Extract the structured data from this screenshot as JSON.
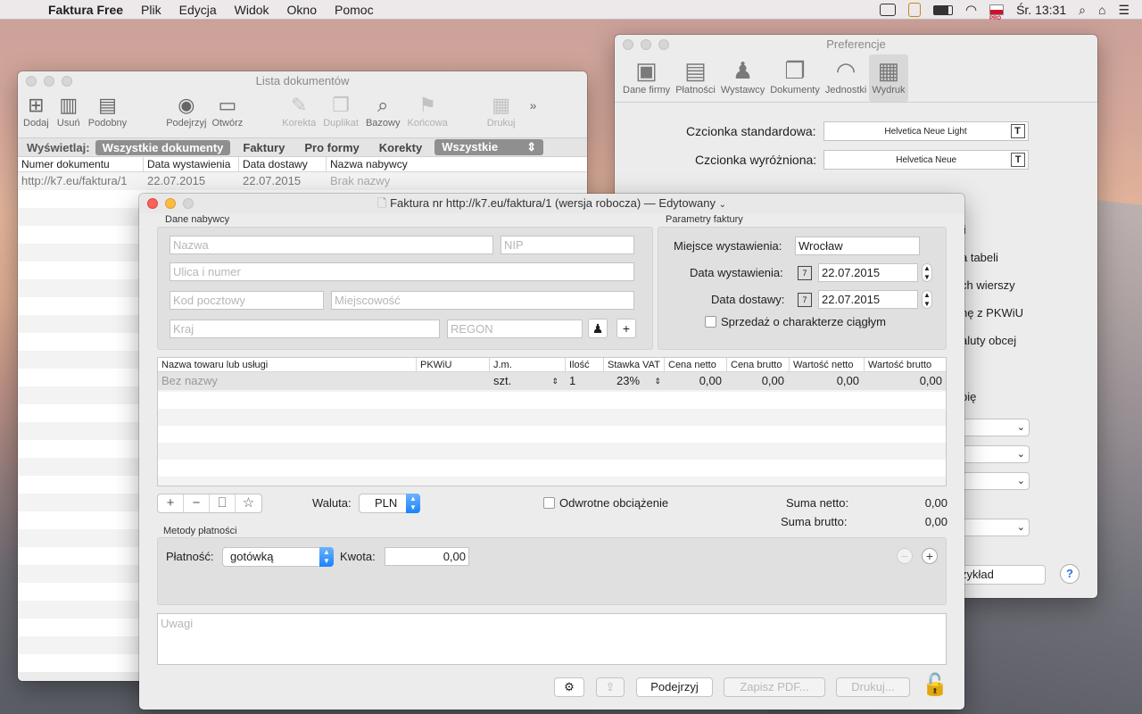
{
  "menubar": {
    "app": "Faktura Free",
    "items": [
      "Plik",
      "Edycja",
      "Widok",
      "Okno",
      "Pomoc"
    ],
    "clock": "Śr. 13:31"
  },
  "list_window": {
    "title": "Lista dokumentów",
    "toolbar": [
      {
        "label": "Dodaj",
        "icon": "add-doc-icon",
        "enabled": true
      },
      {
        "label": "Usuń",
        "icon": "trash-icon",
        "enabled": true
      },
      {
        "label": "Podobny",
        "icon": "similar-doc-icon",
        "enabled": true
      },
      {
        "label": "Podejrzyj",
        "icon": "eye-icon",
        "enabled": true
      },
      {
        "label": "Otwórz",
        "icon": "folder-icon",
        "enabled": true
      },
      {
        "label": "Korekta",
        "icon": "correction-icon",
        "enabled": false
      },
      {
        "label": "Duplikat",
        "icon": "duplicate-icon",
        "enabled": false
      },
      {
        "label": "Bazowy",
        "icon": "magnifier-doc-icon",
        "enabled": true
      },
      {
        "label": "Końcowa",
        "icon": "final-doc-icon",
        "enabled": false
      },
      {
        "label": "Drukuj",
        "icon": "printer-icon",
        "enabled": false
      }
    ],
    "filter": {
      "label": "Wyświetlaj:",
      "options": [
        "Wszystkie dokumenty",
        "Faktury",
        "Pro formy",
        "Korekty"
      ],
      "select": "Wszystkie"
    },
    "columns": [
      "Numer dokumentu",
      "Data wystawienia",
      "Data dostawy",
      "Nazwa nabywcy"
    ],
    "rows": [
      [
        "http://k7.eu/faktura/1",
        "22.07.2015",
        "22.07.2015",
        "Brak nazwy"
      ]
    ]
  },
  "pref_window": {
    "title": "Preferencje",
    "tabs": [
      {
        "label": "Dane firmy",
        "icon": "id-card-icon"
      },
      {
        "label": "Płatności",
        "icon": "wallet-icon"
      },
      {
        "label": "Wystawcy",
        "icon": "people-icon"
      },
      {
        "label": "Dokumenty",
        "icon": "documents-icon"
      },
      {
        "label": "Jednostki",
        "icon": "gauge-icon"
      },
      {
        "label": "Wydruk",
        "icon": "printer-icon"
      }
    ],
    "font_standard_label": "Czcionka standardowa:",
    "font_standard_value": "Helvetica Neue Light",
    "font_emph_label": "Czcionka wyróżniona:",
    "font_emph_value": "Helvetica Neue",
    "fragments": [
      "li",
      "a tabeli",
      "ch wierszy",
      "nę z PKWiU",
      "aluty obcej",
      "pię"
    ],
    "example_button": "zykład"
  },
  "invoice_window": {
    "title": "Faktura nr http://k7.eu/faktura/1 (wersja robocza)",
    "title_suffix": "— Edytowany",
    "buyer": {
      "group": "Dane nabywcy",
      "name_ph": "Nazwa",
      "nip_ph": "NIP",
      "street_ph": "Ulica i numer",
      "postal_ph": "Kod pocztowy",
      "city_ph": "Miejscowość",
      "country_ph": "Kraj",
      "regon_ph": "REGON"
    },
    "params": {
      "group": "Parametry faktury",
      "place_label": "Miejsce wystawienia:",
      "place_value": "Wrocław",
      "issue_label": "Data wystawienia:",
      "issue_value": "22.07.2015",
      "delivery_label": "Data dostawy:",
      "delivery_value": "22.07.2015",
      "continuous_label": "Sprzedaż o charakterze ciągłym"
    },
    "items": {
      "columns": [
        "Nazwa towaru lub usługi",
        "PKWiU",
        "J.m.",
        "Ilość",
        "Stawka VAT",
        "Cena netto",
        "Cena brutto",
        "Wartość netto",
        "Wartość brutto"
      ],
      "rows": [
        [
          "Bez nazwy",
          "",
          "szt.",
          "1",
          "23%",
          "0,00",
          "0,00",
          "0,00",
          "0,00"
        ]
      ]
    },
    "currency_label": "Waluta:",
    "currency_value": "PLN",
    "reverse_charge_label": "Odwrotne obciążenie",
    "sum_net_label": "Suma netto:",
    "sum_net_value": "0,00",
    "sum_gross_label": "Suma brutto:",
    "sum_gross_value": "0,00",
    "payment": {
      "group": "Metody płatności",
      "method_label": "Płatność:",
      "method_value": "gotówką",
      "amount_label": "Kwota:",
      "amount_value": "0,00"
    },
    "notes_ph": "Uwagi",
    "buttons": {
      "preview": "Podejrzyj",
      "save_pdf": "Zapisz PDF...",
      "print": "Drukuj..."
    }
  }
}
